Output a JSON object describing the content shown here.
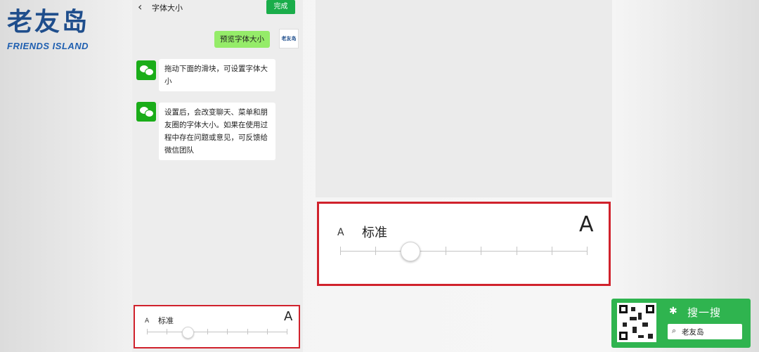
{
  "logo": {
    "cn": "老友岛",
    "en": "FRIENDS ISLAND"
  },
  "phone": {
    "title": "字体大小",
    "done_label": "完成",
    "avatar_text": "老友岛",
    "messages": [
      {
        "from": "me",
        "text": "预览字体大小"
      },
      {
        "from": "wechat",
        "text": "拖动下面的滑块，可设置字体大小"
      },
      {
        "from": "wechat",
        "text": "设置后，会改变聊天、菜单和朋友圈的字体大小。如果在使用过程中存在问题或意见，可反馈给微信团队"
      }
    ]
  },
  "font_slider": {
    "small_label": "A",
    "current_label": "标准",
    "large_label": "A",
    "position": 2,
    "steps": 8
  },
  "search_card": {
    "title": "搜一搜",
    "query": "老友岛"
  },
  "colors": {
    "accent": "#1aad4a",
    "highlight_border": "#d0222c",
    "bubble_me": "#95ec69"
  }
}
